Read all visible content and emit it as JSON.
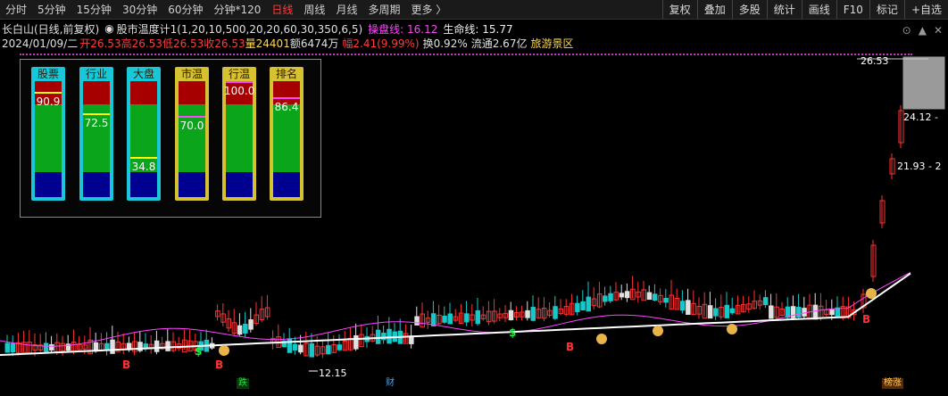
{
  "toolbar": {
    "tabs": [
      "分时",
      "5分钟",
      "15分钟",
      "30分钟",
      "60分钟",
      "分钟*120",
      "日线",
      "周线",
      "月线",
      "多周期",
      "更多 〉"
    ],
    "active_tab": "日线",
    "right_buttons": [
      "复权",
      "叠加",
      "多股",
      "统计",
      "画线",
      "F10",
      "标记",
      "+自选"
    ]
  },
  "info": {
    "stock_name": "长白山(日线,前复权)",
    "indicator": "股市温度计1(1,20,10,500,20,20,60,30,350,6,5)",
    "pan_label": "操盘线: 16.12",
    "life_label": "生命线: 15.77",
    "date": "2024/01/09/二",
    "open": "开26.53",
    "high": "高26.53",
    "low": "低26.53",
    "close": "收26.53",
    "volume": "量24401",
    "amount": "额6474万",
    "change": "幅2.41(9.99%)",
    "turnover": "换0.92%",
    "float": "流通2.67亿",
    "sector": "旅游景区"
  },
  "window_controls": [
    "⊙",
    "▲",
    "✕"
  ],
  "gauges": [
    {
      "label": "股票",
      "value": "90.9",
      "level": 0.909,
      "style": "cyan",
      "mark_color": "#ffff00"
    },
    {
      "label": "行业",
      "value": "72.5",
      "level": 0.725,
      "style": "cyan",
      "mark_color": "#ffff00"
    },
    {
      "label": "大盘",
      "value": "34.8",
      "level": 0.348,
      "style": "cyan",
      "mark_color": "#ffff00"
    },
    {
      "label": "市温",
      "value": "70.0",
      "level": 0.7,
      "style": "yel",
      "mark_color": "#ff44ff"
    },
    {
      "label": "行温",
      "value": "100.0",
      "level": 1.0,
      "style": "yel",
      "mark_color": "#ff44ff"
    },
    {
      "label": "排名",
      "value": "86.4",
      "level": 0.864,
      "style": "yel",
      "mark_color": "#ff44ff"
    }
  ],
  "price_labels": {
    "top": "26.53",
    "mid": "24.12 -",
    "low": "21.93 - 2",
    "min": "12.15"
  },
  "markers": {
    "b": "B",
    "s": "$",
    "bag": "💰",
    "bottom_labels": [
      "跌",
      "财",
      "榜涨"
    ]
  },
  "colors": {
    "up": "#ff3232",
    "down": "#16c8c8",
    "flat": "#e0e0e0",
    "pan_line": "#ffffff",
    "life_line": "#ff44ff"
  }
}
